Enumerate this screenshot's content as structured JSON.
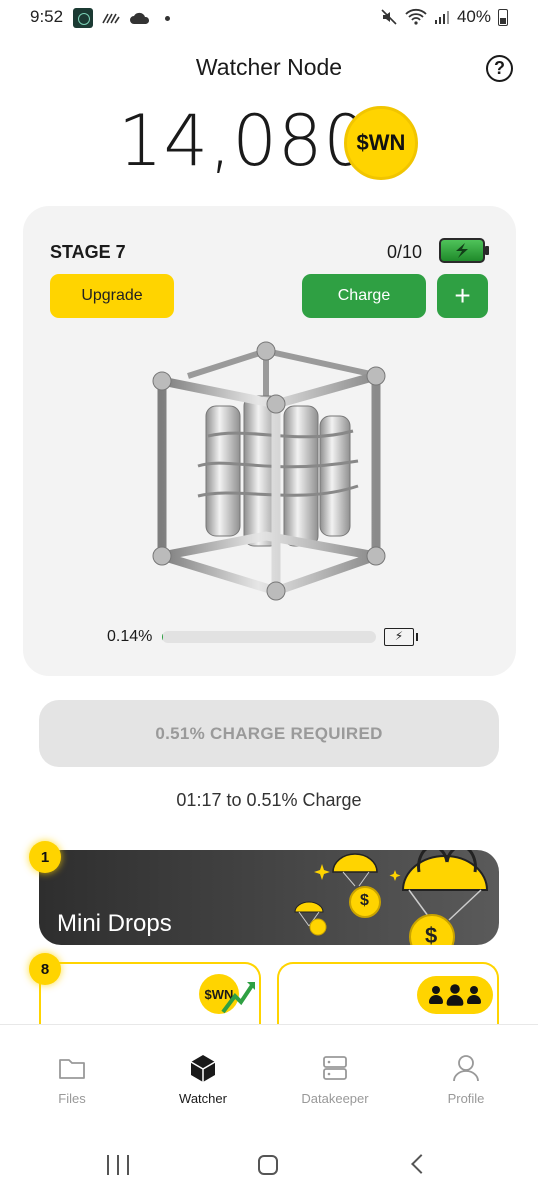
{
  "status_bar": {
    "time": "9:52",
    "battery": "40%",
    "icons": [
      "app-icon",
      "activity-icon",
      "cloud-icon",
      "mute-icon",
      "wifi-icon",
      "signal-icon",
      "battery-icon"
    ]
  },
  "header": {
    "title": "Watcher Node",
    "help_icon": "?"
  },
  "balance": {
    "amount": "14,080",
    "token": "$WN"
  },
  "node_card": {
    "stage": "STAGE 7",
    "charges": "0/10",
    "upgrade_label": "Upgrade",
    "charge_label": "Charge",
    "plus_label": "+",
    "progress_label": "0.14%",
    "progress_value": 0.0014,
    "battery_glyph": "⚡"
  },
  "charge_status": {
    "button_label": "0.51% CHARGE REQUIRED",
    "timer_text": "01:17 to 0.51% Charge"
  },
  "mini_drops": {
    "badge": "1",
    "title": "Mini Drops",
    "coin_symbol": "$"
  },
  "tasks": {
    "badge": "8",
    "coin_label": "$WN"
  },
  "bottom_nav": {
    "items": [
      {
        "label": "Files",
        "icon": "folder-icon",
        "active": false
      },
      {
        "label": "Watcher",
        "icon": "cube-icon",
        "active": true
      },
      {
        "label": "Datakeeper",
        "icon": "server-icon",
        "active": false
      },
      {
        "label": "Profile",
        "icon": "user-icon",
        "active": false
      }
    ]
  },
  "colors": {
    "accent_yellow": "#ffd400",
    "accent_green": "#2fa043",
    "card_bg": "#f3f3f3"
  }
}
